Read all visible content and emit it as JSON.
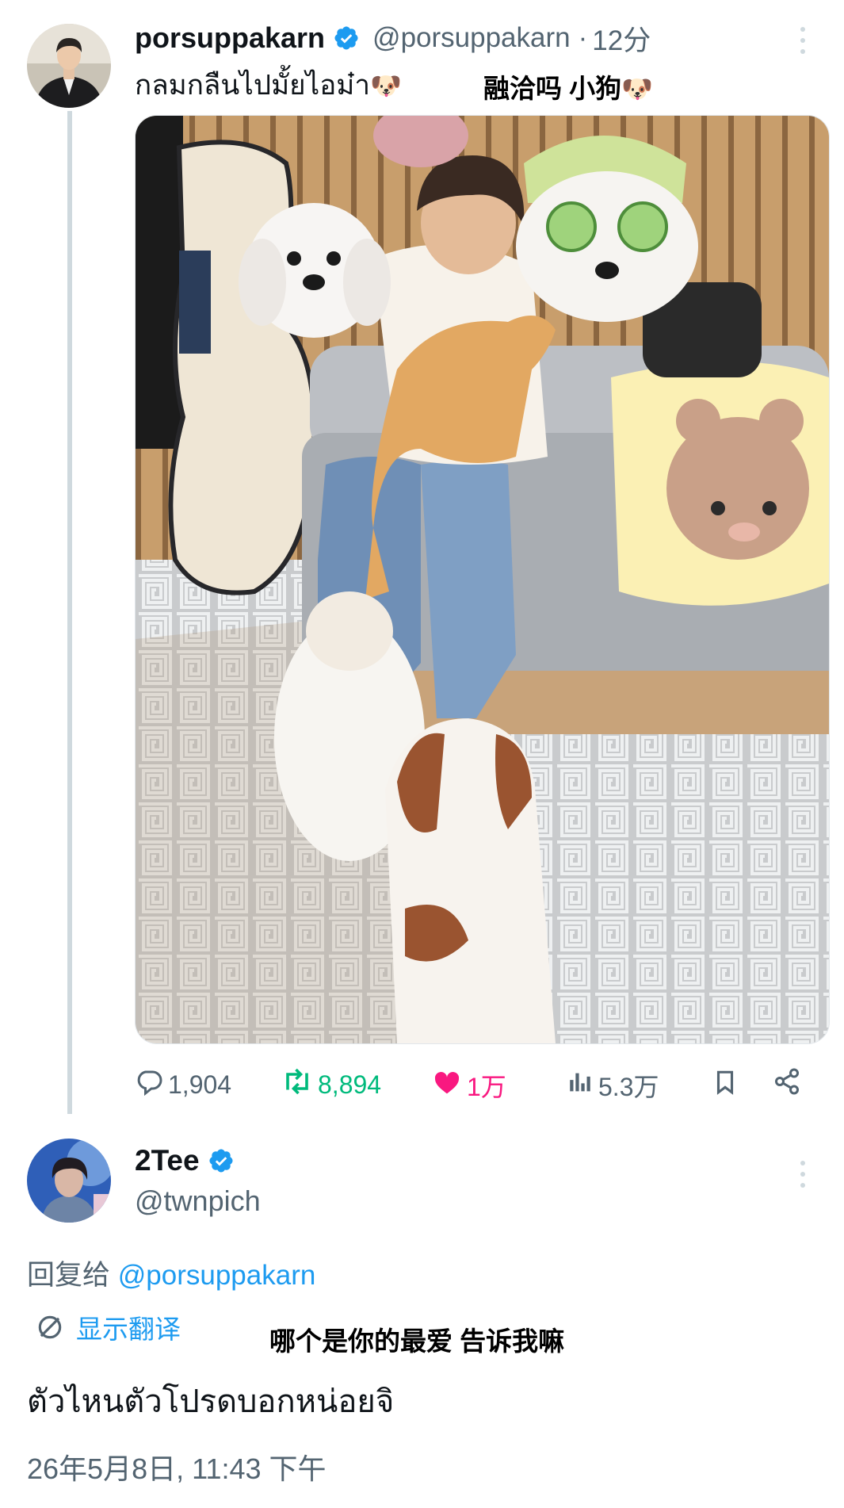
{
  "original_tweet": {
    "display_name": "porsuppakarn",
    "handle": "@porsuppakarn",
    "time_separator": "·",
    "time": "12分",
    "text": "กลมกลืนไปมั้ยไอม๋า",
    "text_emoji": "🐶",
    "caption_overlay": "融洽吗 小狗",
    "caption_emoji": "🐶",
    "stats": {
      "replies": "1,904",
      "retweets": "8,894",
      "likes": "1万",
      "views": "5.3万"
    }
  },
  "reply_tweet": {
    "display_name": "2Tee",
    "handle": "@twnpich",
    "replying_to_label": "回复给",
    "replying_to_handle": "@porsuppakarn",
    "translate_label": "显示翻译",
    "caption_overlay": "哪个是你的最爱 告诉我嘛",
    "text": "ตัวไหนตัวโปรดบอกหน่อยจิ",
    "timestamp": "26年5月8日, 11:43 下午"
  },
  "icons": {
    "verified": "verified-badge-icon",
    "more": "more-options-icon",
    "reply": "reply-icon",
    "retweet": "retweet-icon",
    "like": "heart-icon",
    "views": "views-icon",
    "bookmark": "bookmark-icon",
    "share": "share-icon",
    "translate": "translate-icon"
  },
  "colors": {
    "verified": "#1d9bf0",
    "retweet": "#00ba7c",
    "like": "#f91880",
    "link": "#1d9bf0",
    "muted": "#536471"
  }
}
